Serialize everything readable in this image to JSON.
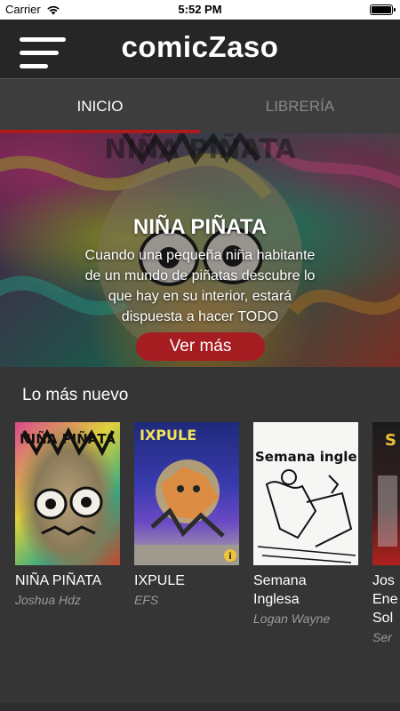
{
  "status": {
    "carrier": "Carrier",
    "time": "5:52 PM"
  },
  "app": {
    "title": "comicZaso"
  },
  "tabs": [
    {
      "label": "INICIO",
      "active": true
    },
    {
      "label": "LIBRERÍA",
      "active": false
    }
  ],
  "hero": {
    "title": "NIÑA PIÑATA",
    "description": "Cuando una pequeña niña habitante de un mundo de piñatas descubre lo que hay en su interior, estará dispuesta a hacer TODO",
    "button_label": "Ver más",
    "cover_text": "NIÑA PIÑATA"
  },
  "section": {
    "title": "Lo más nuevo"
  },
  "comics": [
    {
      "title": "NIÑA PIÑATA",
      "author": "Joshua Hdz",
      "cover_text": "NIÑA PIÑATA"
    },
    {
      "title": "IXPULE",
      "author": "EFS",
      "cover_text": "IXPULE"
    },
    {
      "title": "Semana Inglesa",
      "author": "Logan Wayne",
      "cover_text": "Semana ingle"
    },
    {
      "title": "Jos Ene Sol",
      "author": "Ser",
      "cover_text": "S"
    }
  ],
  "colors": {
    "accent": "#b01a1f",
    "nav_bg": "#262626",
    "tab_bg": "#3d3d3d",
    "body_bg": "#353535"
  },
  "icons": {
    "menu": "hamburger-icon",
    "wifi": "wifi-icon",
    "battery": "battery-icon",
    "info": "info-icon"
  }
}
